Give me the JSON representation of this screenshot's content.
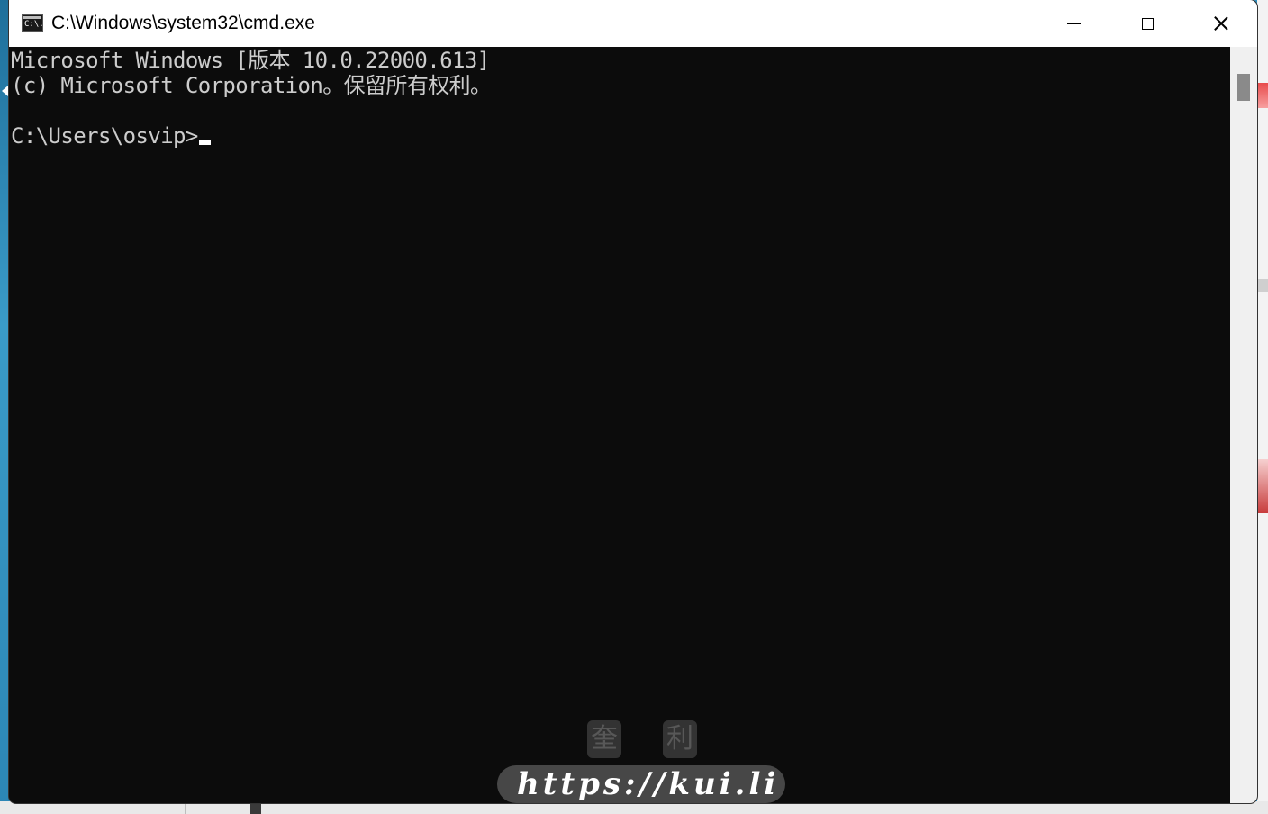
{
  "window": {
    "title": "C:\\Windows\\system32\\cmd.exe",
    "icon_label": "C:\\."
  },
  "controls": {
    "minimize": "minimize",
    "maximize": "maximize",
    "close": "close"
  },
  "console": {
    "lines": [
      "Microsoft Windows [版本 10.0.22000.613]",
      "(c) Microsoft Corporation。保留所有权利。",
      "",
      "C:\\Users\\osvip>"
    ]
  },
  "watermark": {
    "chars": [
      "奎",
      "利"
    ],
    "url": "https://kui.li"
  },
  "colors": {
    "console_bg": "#0c0c0c",
    "console_fg": "#cccccc",
    "titlebar_bg": "#ffffff"
  }
}
